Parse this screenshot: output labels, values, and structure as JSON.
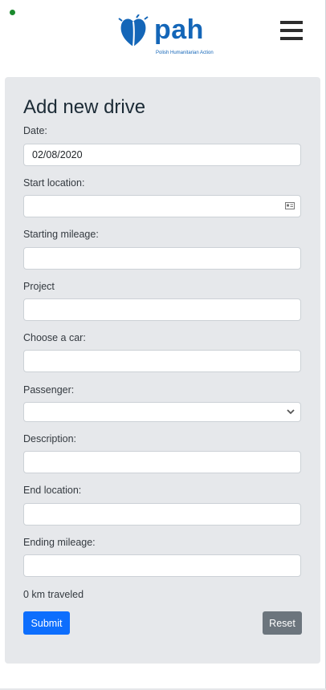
{
  "header": {
    "logo_text": "pah",
    "logo_tagline": "Polish Humanitarian Action",
    "menu_icon": "hamburger-menu-icon"
  },
  "form": {
    "title": "Add new drive",
    "date": {
      "label": "Date:",
      "value": "02/08/2020"
    },
    "start_location": {
      "label": "Start location:",
      "value": "",
      "icon": "contact-card-icon"
    },
    "starting_mileage": {
      "label": "Starting mileage:",
      "value": ""
    },
    "project": {
      "label": "Project",
      "value": ""
    },
    "car": {
      "label": "Choose a car:",
      "value": ""
    },
    "passenger": {
      "label": "Passenger:",
      "value": "",
      "icon": "chevron-down-icon"
    },
    "description": {
      "label": "Description:",
      "value": ""
    },
    "end_location": {
      "label": "End location:",
      "value": ""
    },
    "ending_mileage": {
      "label": "Ending mileage:",
      "value": ""
    },
    "traveled_text": "0 km traveled",
    "submit_label": "Submit",
    "reset_label": "Reset"
  },
  "colors": {
    "brand": "#1466b8",
    "card_bg": "#e6e8eb",
    "submit": "#0d6efd",
    "reset": "#6c757d",
    "status_dot": "#1b8a2e"
  }
}
